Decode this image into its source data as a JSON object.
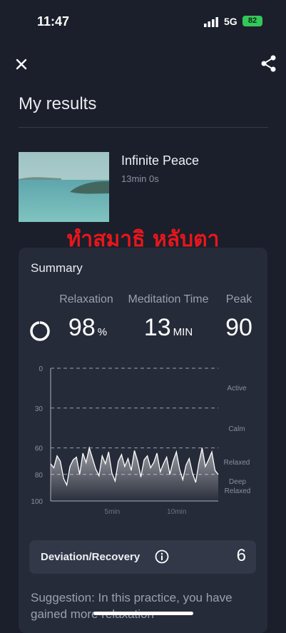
{
  "status": {
    "time": "11:47",
    "network": "5G",
    "battery": "82"
  },
  "header": {
    "close_icon": "close-icon",
    "share_icon": "share-icon"
  },
  "page_title": "My results",
  "track": {
    "title": "Infinite Peace",
    "duration": "13min 0s"
  },
  "overlay_text": "ทำสมาธิ หลับตา",
  "summary": {
    "title": "Summary",
    "stats": [
      {
        "label": "Relaxation",
        "value": "98",
        "unit": "%"
      },
      {
        "label": "Meditation Time",
        "value": "13",
        "unit": "MIN"
      },
      {
        "label": "Peak",
        "value": "90",
        "unit": ""
      }
    ]
  },
  "chart_data": {
    "type": "line",
    "y_ticks": [
      "0",
      "30",
      "60",
      "80",
      "100"
    ],
    "ylim": [
      0,
      100
    ],
    "y_inverted": true,
    "zones": [
      "Active",
      "Calm",
      "Relaxed",
      "Deep Relaxed"
    ],
    "x_ticks": [
      "5min",
      "10min"
    ],
    "x_range_min": [
      0,
      13
    ],
    "series": [
      {
        "x": [
          0,
          0.25,
          0.5,
          0.75,
          1,
          1.25,
          1.5,
          1.75,
          2,
          2.25,
          2.5,
          2.75,
          3,
          3.25,
          3.5,
          3.75,
          4,
          4.25,
          4.5,
          4.75,
          5,
          5.25,
          5.5,
          5.75,
          6,
          6.25,
          6.5,
          6.75,
          7,
          7.25,
          7.5,
          7.75,
          8,
          8.25,
          8.5,
          8.75,
          9,
          9.25,
          9.5,
          9.75,
          10,
          10.25,
          10.5,
          10.75,
          11,
          11.25,
          11.5,
          11.75,
          12,
          12.25,
          12.5,
          12.75,
          13
        ],
        "y": [
          72,
          75,
          66,
          70,
          83,
          88,
          74,
          69,
          67,
          80,
          64,
          71,
          60,
          68,
          76,
          81,
          66,
          72,
          63,
          79,
          85,
          70,
          65,
          74,
          68,
          77,
          62,
          70,
          82,
          69,
          66,
          75,
          71,
          64,
          78,
          72,
          67,
          80,
          70,
          63,
          76,
          84,
          73,
          68,
          79,
          86,
          71,
          60,
          74,
          69,
          63,
          77,
          80
        ]
      }
    ]
  },
  "deviation": {
    "label": "Deviation/Recovery",
    "value": "6"
  },
  "suggestion": "Suggestion: In this practice, you have gained more relaxation"
}
